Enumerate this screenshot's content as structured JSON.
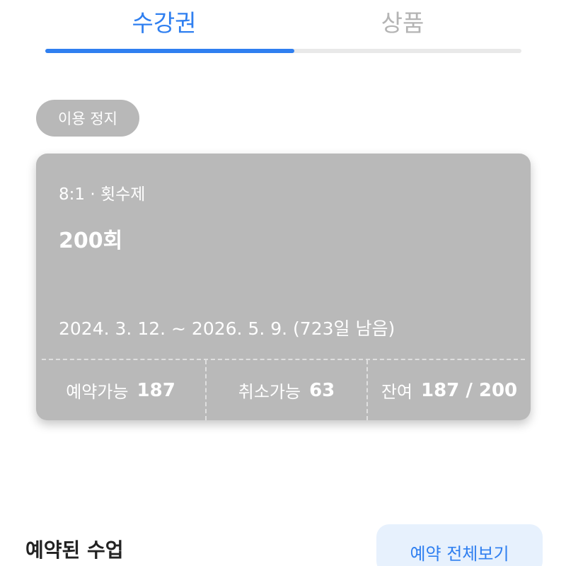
{
  "tabs": [
    {
      "label": "수강권",
      "active": true
    },
    {
      "label": "상품",
      "active": false
    }
  ],
  "status_chip": "이용 정지",
  "pass_card": {
    "subtitle": "8:1 · 횟수제",
    "count": "200회",
    "period": "2024. 3. 12. ~ 2026. 5. 9. (723일 남음)",
    "stats": [
      {
        "label": "예약가능",
        "value": "187"
      },
      {
        "label": "취소가능",
        "value": "63"
      },
      {
        "label": "잔여",
        "value": "187 / 200"
      }
    ]
  },
  "reserved": {
    "title": "예약된 수업",
    "view_all_label": "예약 전체보기"
  },
  "colors": {
    "accent": "#2f7ff0",
    "card_bg": "#b9b9b9",
    "chip_bg": "#b8b8b8",
    "view_all_bg": "#e7f1fd"
  }
}
